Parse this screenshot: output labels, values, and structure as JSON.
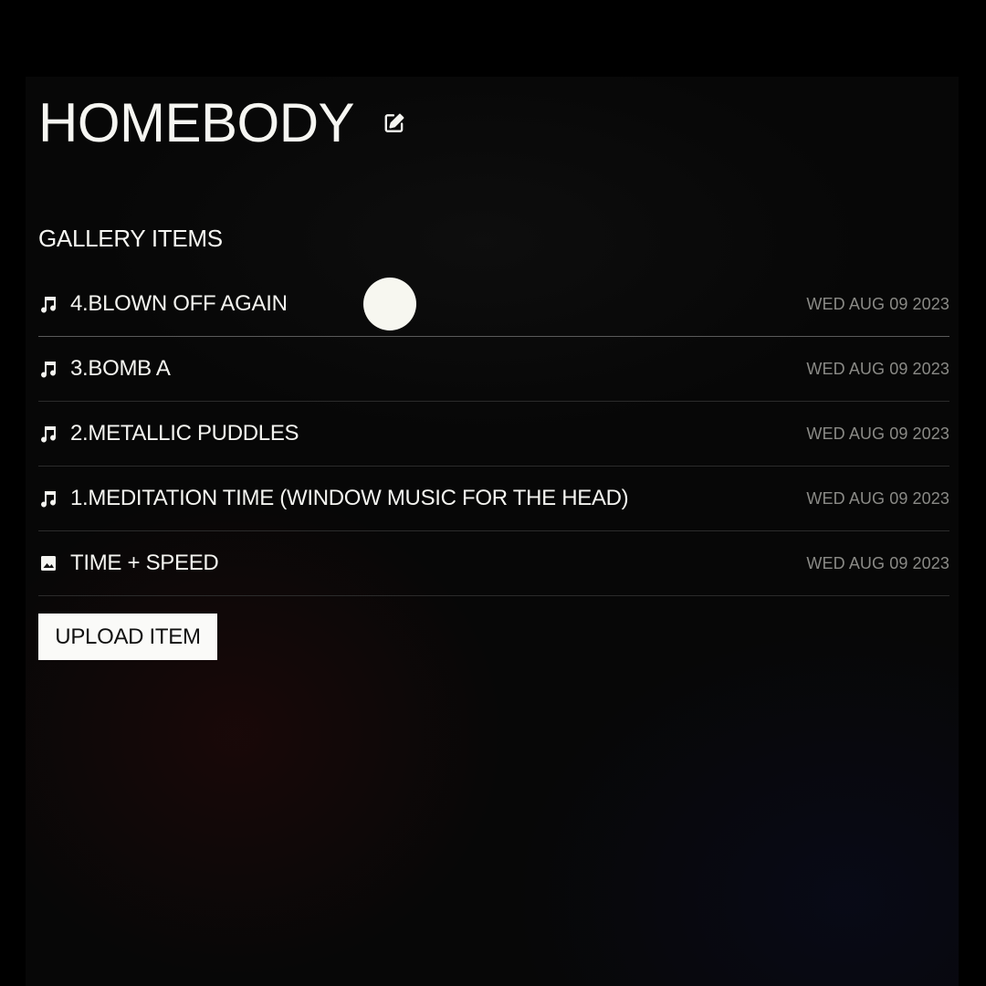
{
  "page": {
    "title": "HOMEBODY"
  },
  "gallery": {
    "section_title": "GALLERY ITEMS",
    "items": [
      {
        "icon": "music-note-icon",
        "name": "4.BLOWN OFF AGAIN",
        "date": "WED AUG 09 2023"
      },
      {
        "icon": "music-note-icon",
        "name": "3.BOMB A",
        "date": "WED AUG 09 2023"
      },
      {
        "icon": "music-note-icon",
        "name": "2.METALLIC PUDDLES",
        "date": "WED AUG 09 2023"
      },
      {
        "icon": "music-note-icon",
        "name": "1.MEDITATION TIME (WINDOW MUSIC FOR THE HEAD)",
        "date": "WED AUG 09 2023"
      },
      {
        "icon": "image-icon",
        "name": "TIME + SPEED",
        "date": "WED AUG 09 2023"
      }
    ]
  },
  "actions": {
    "upload_label": "UPLOAD ITEM"
  },
  "colors": {
    "background": "#000000",
    "text": "#f4f4f0",
    "date_text": "#8a8a86",
    "divider": "#2b2b2b",
    "button_bg": "#fafaf8"
  }
}
